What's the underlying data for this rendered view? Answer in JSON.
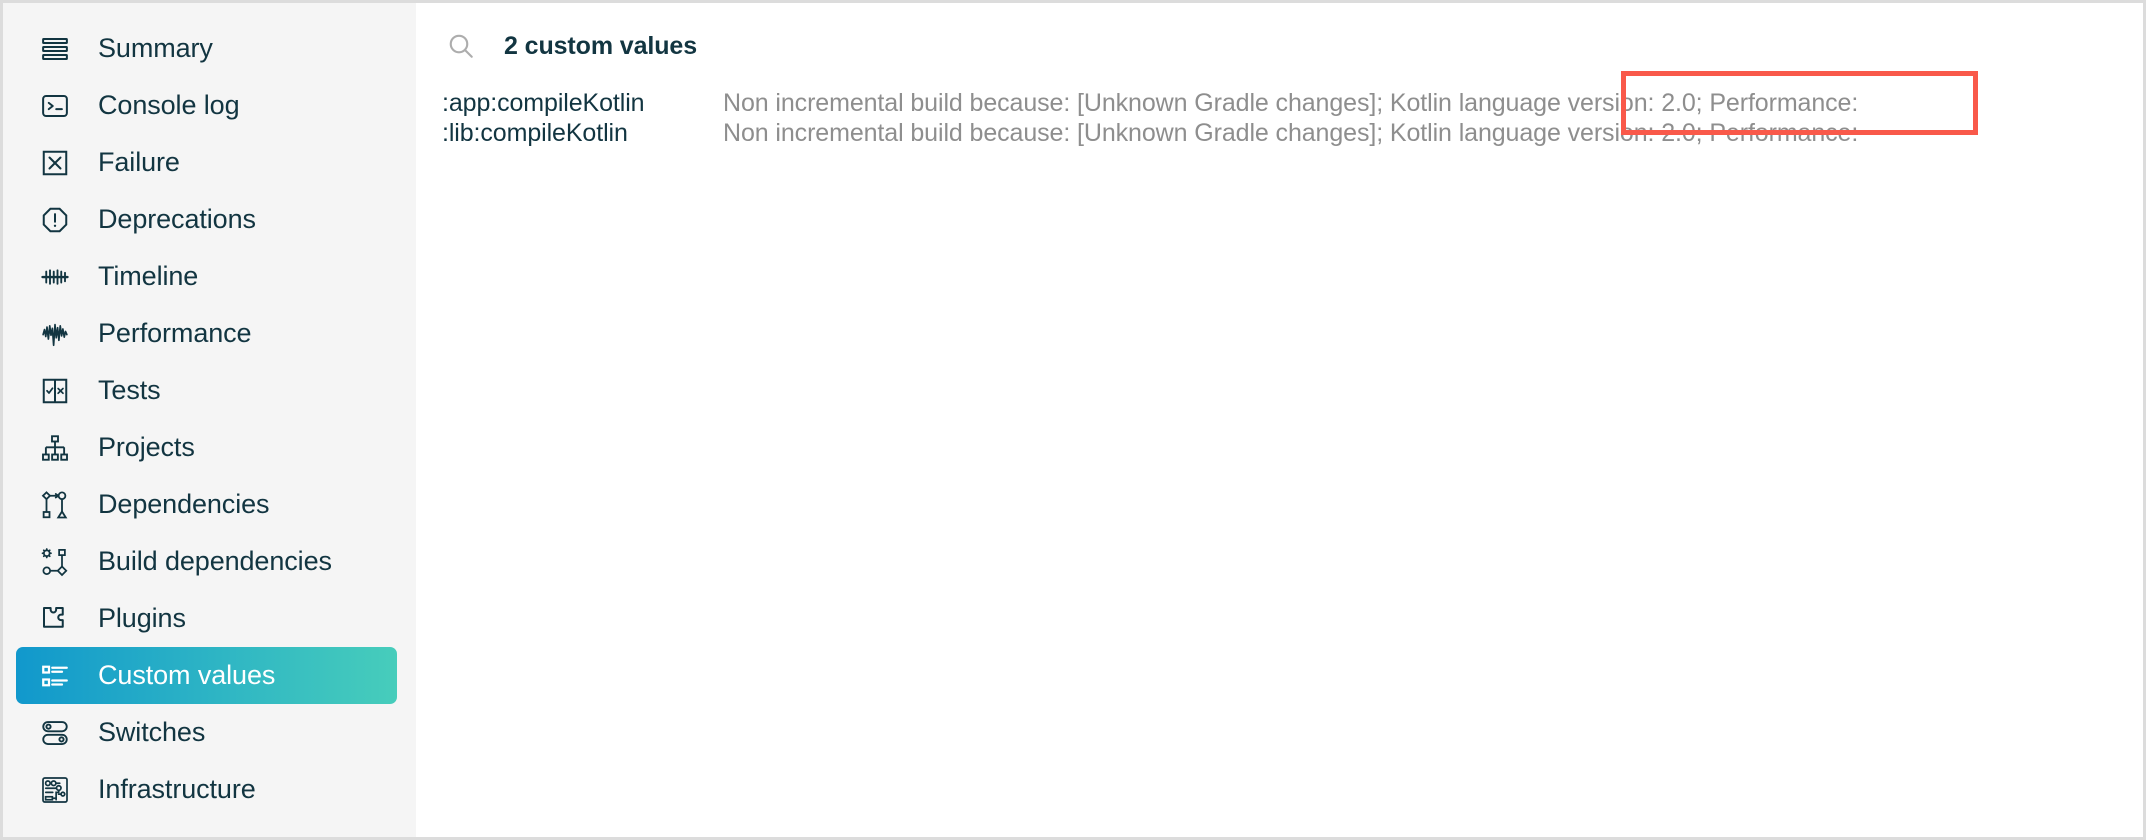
{
  "sidebar": {
    "items": [
      {
        "label": "Summary",
        "icon": "summary-lines-icon",
        "selected": false
      },
      {
        "label": "Console log",
        "icon": "console-terminal-icon",
        "selected": false
      },
      {
        "label": "Failure",
        "icon": "failure-x-box-icon",
        "selected": false
      },
      {
        "label": "Deprecations",
        "icon": "deprecation-warning-icon",
        "selected": false
      },
      {
        "label": "Timeline",
        "icon": "timeline-ticks-icon",
        "selected": false
      },
      {
        "label": "Performance",
        "icon": "performance-waveform-icon",
        "selected": false
      },
      {
        "label": "Tests",
        "icon": "tests-checkbox-icon",
        "selected": false
      },
      {
        "label": "Projects",
        "icon": "projects-tree-icon",
        "selected": false
      },
      {
        "label": "Dependencies",
        "icon": "dependencies-graph-icon",
        "selected": false
      },
      {
        "label": "Build dependencies",
        "icon": "build-dependencies-icon",
        "selected": false
      },
      {
        "label": "Plugins",
        "icon": "plugin-puzzle-icon",
        "selected": false
      },
      {
        "label": "Custom values",
        "icon": "custom-values-list-icon",
        "selected": true
      },
      {
        "label": "Switches",
        "icon": "switches-toggle-icon",
        "selected": false
      },
      {
        "label": "Infrastructure",
        "icon": "infrastructure-chip-icon",
        "selected": false
      }
    ],
    "selected_gradient_from": "#1198cc",
    "selected_gradient_to": "#47cdbb",
    "background": "#f5f5f5",
    "text_color": "#123541"
  },
  "header": {
    "icon": "search-icon",
    "title": "2 custom values",
    "icon_color": "#adadad"
  },
  "custom_values": {
    "columns": [
      "key",
      "value"
    ],
    "rows": [
      {
        "key": ":app:compileKotlin",
        "value": "Non incremental build because: [Unknown Gradle changes]; Kotlin language version: 2.0; Performance:"
      },
      {
        "key": ":lib:compileKotlin",
        "value": "Non incremental build because: [Unknown Gradle changes]; Kotlin language version: 2.0; Performance:"
      }
    ],
    "key_color": "#123541",
    "value_color": "#8e8e8e"
  },
  "annotation": {
    "name": "kotlin-language-version-highlight",
    "highlighted_text": "Kotlin language version: 2.0;",
    "color": "#f9594a"
  }
}
